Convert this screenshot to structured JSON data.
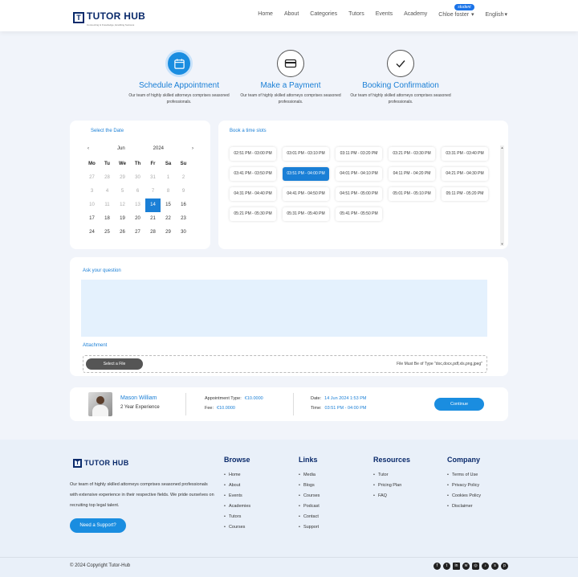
{
  "header": {
    "brand": "TUTOR HUB",
    "tagline": "Connecting & Knowledge, Enabling Success",
    "nav": [
      "Home",
      "About",
      "Categories",
      "Tutors",
      "Events",
      "Academy"
    ],
    "user_name": "Chloe foster",
    "user_badge": "student",
    "language": "English"
  },
  "steps": [
    {
      "title": "Schedule Appointment",
      "desc": "Our team of highly skilled attorneys comprises seasoned professionals.",
      "icon": "calendar-icon"
    },
    {
      "title": "Make a Payment",
      "desc": "Our team of highly skilled attorneys comprises seasoned professionals.",
      "icon": "credit-card-icon"
    },
    {
      "title": "Booking Confirmation",
      "desc": "Our team of highly skilled attorneys comprises seasoned professionals.",
      "icon": "check-icon"
    }
  ],
  "calendar": {
    "title": "Select the Date",
    "month": "Jun",
    "year": "2024",
    "days_of_week": [
      "Mo",
      "Tu",
      "We",
      "Th",
      "Fr",
      "Sa",
      "Su"
    ],
    "rows": [
      [
        "27",
        "28",
        "29",
        "30",
        "31",
        "1",
        "2"
      ],
      [
        "3",
        "4",
        "5",
        "6",
        "7",
        "8",
        "9"
      ],
      [
        "10",
        "11",
        "12",
        "13",
        "14",
        "15",
        "16"
      ],
      [
        "17",
        "18",
        "19",
        "20",
        "21",
        "22",
        "23"
      ],
      [
        "24",
        "25",
        "26",
        "27",
        "28",
        "29",
        "30"
      ]
    ],
    "selected": "14"
  },
  "time_slots": {
    "title": "Book a time slots",
    "slots": [
      "02:51 PM - 03:00 PM",
      "03:01 PM - 03:10 PM",
      "03:11 PM - 03:20 PM",
      "03:21 PM - 03:30 PM",
      "03:31 PM - 03:40 PM",
      "03:41 PM - 03:50 PM",
      "03:51 PM - 04:00 PM",
      "04:01 PM - 04:10 PM",
      "04:11 PM - 04:20 PM",
      "04:21 PM - 04:30 PM",
      "04:31 PM - 04:40 PM",
      "04:41 PM - 04:50 PM",
      "04:51 PM - 05:00 PM",
      "05:01 PM - 05:10 PM",
      "05:11 PM - 05:20 PM",
      "05:21 PM - 05:30 PM",
      "05:31 PM - 05:40 PM",
      "05:41 PM - 05:50 PM"
    ],
    "selected": "03:51 PM - 04:00 PM"
  },
  "question": {
    "title": "Ask your question",
    "value": "",
    "attachment_label": "Attachment",
    "file_button": "Select a File",
    "file_note": "File Must Be of Type \"doc,docx,pdf,xls,png,jpeg\""
  },
  "summary": {
    "tutor_name": "Mason William",
    "experience": "2 Year Experience",
    "type_label": "Appointment Type:",
    "type_value": "€10.0000",
    "fee_label": "Fee:",
    "fee_value": "€10.0000",
    "date_label": "Date:",
    "date_value": "14 Jun 2024 1:53 PM",
    "time_label": "Time:",
    "time_value": "03:51 PM - 04:00 PM",
    "continue_label": "Continue"
  },
  "footer": {
    "brand": "TUTOR HUB",
    "about": "Our team of highly skilled attorneys comprises seasoned professionals with extensive experience in their respective fields. We pride ourselves on recruiting top legal talent.",
    "support_button": "Need a Support?",
    "columns": [
      {
        "title": "Browse",
        "items": [
          "Home",
          "About",
          "Events",
          "Academies",
          "Tutors",
          "Courses"
        ]
      },
      {
        "title": "Links",
        "items": [
          "Media",
          "Blogs",
          "Courses",
          "Podcast",
          "Contact",
          "Support"
        ]
      },
      {
        "title": "Resources",
        "items": [
          "Tutor",
          "Pricing Plan",
          "FAQ"
        ]
      },
      {
        "title": "Company",
        "items": [
          "Terms of Use",
          "Privacy Policy",
          "Cookies Policy",
          "Disclaimer"
        ]
      }
    ],
    "copyright": "© 2024 Copyright Tutor-Hub",
    "social": [
      "facebook-icon",
      "twitter-icon",
      "linkedin-icon",
      "whatsapp-icon",
      "instagram-icon",
      "tiktok-icon",
      "snapchat-icon",
      "pinterest-icon"
    ]
  }
}
